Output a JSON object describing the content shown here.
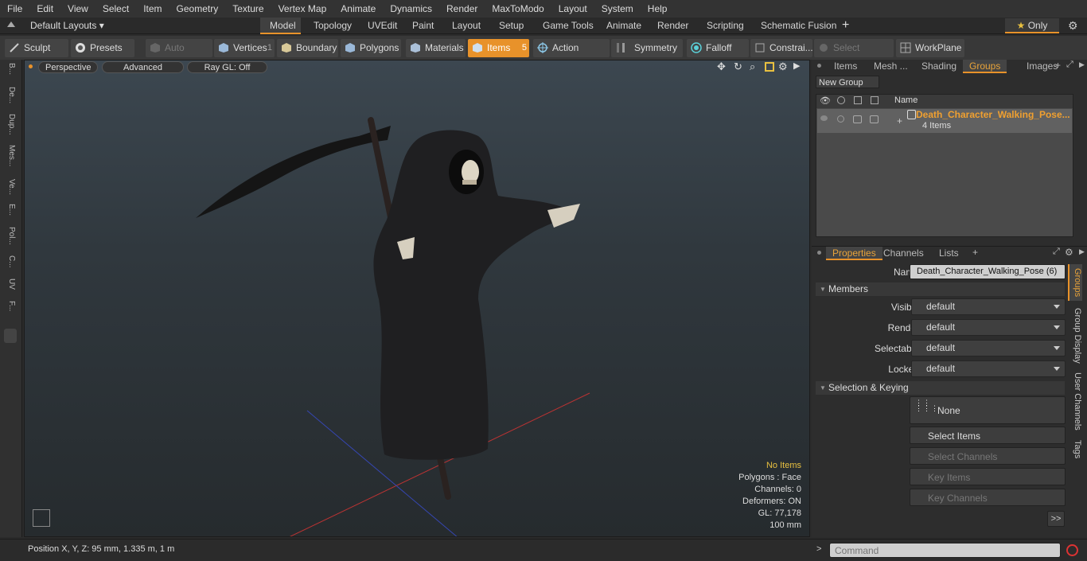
{
  "menu": [
    "File",
    "Edit",
    "View",
    "Select",
    "Item",
    "Geometry",
    "Texture",
    "Vertex Map",
    "Animate",
    "Dynamics",
    "Render",
    "MaxToModo",
    "Layout",
    "System",
    "Help"
  ],
  "layout_bar": {
    "layouts_label": "Default Layouts",
    "tabs": [
      "Model",
      "Topology",
      "UVEdit",
      "Paint",
      "Layout",
      "Setup",
      "Game Tools",
      "Animate",
      "Render",
      "Scripting",
      "Schematic Fusion"
    ],
    "active_tab": "Model",
    "only_label": "Only"
  },
  "toolbar": {
    "sculpt": "Sculpt",
    "presets": "Presets",
    "auto_select": "Auto Select",
    "vertices": "Vertices",
    "vertices_count": "1",
    "boundary": "Boundary",
    "polygons": "Polygons",
    "materials": "Materials",
    "items": "Items",
    "items_count": "5",
    "action_center": "Action Center",
    "symmetry": "Symmetry",
    "falloff": "Falloff",
    "constraints": "Constrai...",
    "select_through": "Select Through",
    "workplane": "WorkPlane"
  },
  "left_tabs": [
    "B...",
    "De...",
    "Dup...",
    "Mes...",
    "Ve...",
    "E...",
    "Pol...",
    "C...",
    "UV",
    "F..."
  ],
  "viewport": {
    "perspective": "Perspective",
    "advanced": "Advanced",
    "raygl": "Ray GL: Off",
    "info": {
      "no_items": "No Items",
      "polygons": "Polygons : Face",
      "channels": "Channels: 0",
      "deformers": "Deformers: ON",
      "gl": "GL: 77,178",
      "scale": "100 mm"
    }
  },
  "status": {
    "position": "Position X, Y, Z:  95 mm, 1.335 m, 1 m",
    "command_placeholder": "Command"
  },
  "top_panel": {
    "tabs": [
      "Items",
      "Mesh ...",
      "Shading",
      "Groups",
      "Images"
    ],
    "active_tab": "Groups",
    "new_group": "New Group",
    "name_header": "Name",
    "group_name": "Death_Character_Walking_Pose...",
    "group_items": "4 Items"
  },
  "properties": {
    "tabs": [
      "Properties",
      "Channels",
      "Lists"
    ],
    "active_tab": "Properties",
    "name_label": "Name",
    "name_value": "Death_Character_Walking_Pose (6)",
    "members_section": "Members",
    "fields": [
      {
        "label": "Visible",
        "value": "default"
      },
      {
        "label": "Render",
        "value": "default"
      },
      {
        "label": "Selectable",
        "value": "default"
      },
      {
        "label": "Locked",
        "value": "default"
      }
    ],
    "selection_section": "Selection & Keying",
    "none_label": "None",
    "select_items": "Select Items",
    "select_channels": "Select Channels",
    "key_items": "Key Items",
    "key_channels": "Key Channels",
    "more": ">>",
    "side_tabs": [
      "Groups",
      "Group Display",
      "User Channels",
      "Tags"
    ]
  },
  "colors": {
    "accent": "#e8922a",
    "group_name": "#f0a030"
  }
}
